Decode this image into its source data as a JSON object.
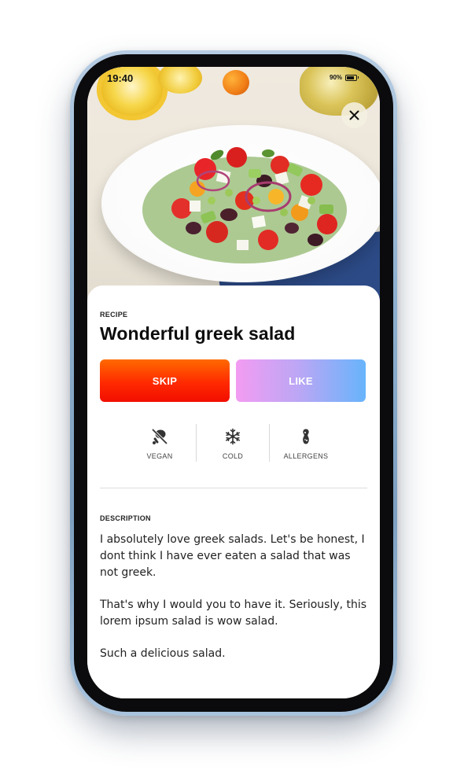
{
  "status_bar": {
    "time": "19:40",
    "battery_percent": "90%",
    "battery_level": 0.9
  },
  "hero": {
    "close_icon": "close-icon"
  },
  "recipe": {
    "eyebrow": "RECIPE",
    "title": "Wonderful greek salad"
  },
  "actions": {
    "skip_label": "SKIP",
    "like_label": "LIKE"
  },
  "features": [
    {
      "label": "VEGAN",
      "icon": "no-meat-icon"
    },
    {
      "label": "COLD",
      "icon": "snowflake-icon"
    },
    {
      "label": "ALLERGENS",
      "icon": "peanut-icon"
    }
  ],
  "description": {
    "eyebrow": "DESCRIPTION",
    "paragraphs": [
      "I absolutely love greek salads. Let's be honest, I dont think I have ever eaten a salad that was not greek.",
      "That's why I would you to have it. Seriously, this lorem ipsum salad is wow salad.",
      "Such a delicious salad."
    ]
  },
  "colors": {
    "skip_gradient": [
      "#ff6a00",
      "#f20d00"
    ],
    "like_gradient": [
      "#f39cf2",
      "#67b4fb"
    ],
    "phone_frame": "#8fb0cf"
  }
}
